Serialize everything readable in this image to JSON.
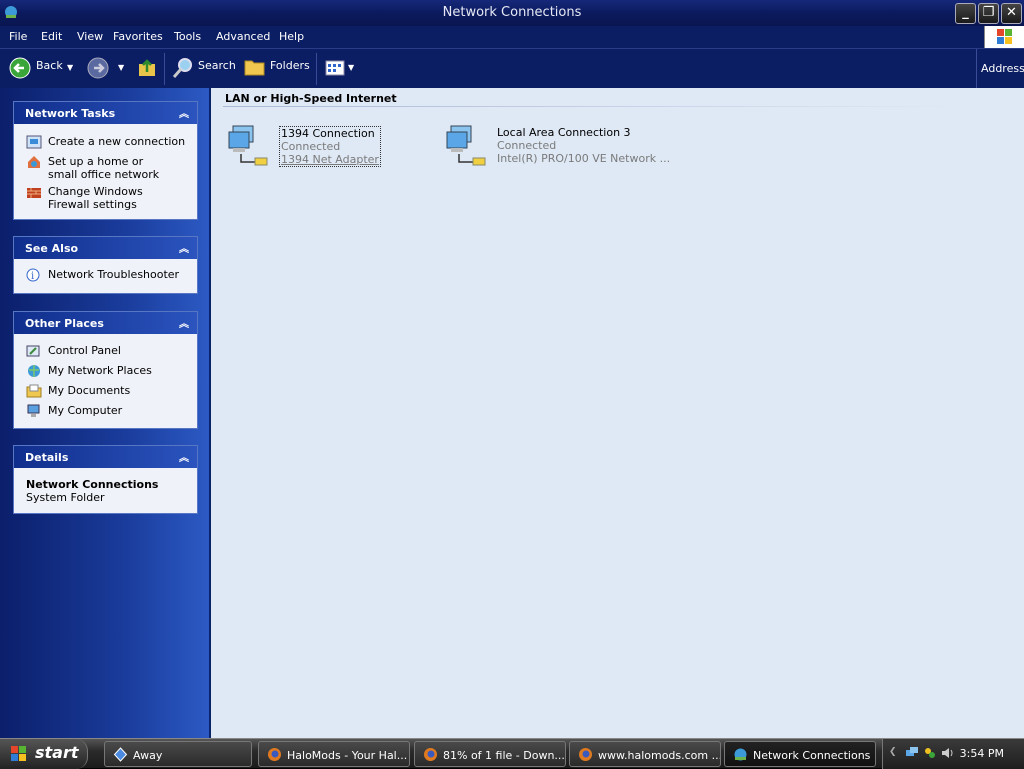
{
  "window": {
    "title": "Network Connections"
  },
  "menubar": [
    "File",
    "Edit",
    "View",
    "Favorites",
    "Tools",
    "Advanced",
    "Help"
  ],
  "toolbar": {
    "back": "Back",
    "search": "Search",
    "folders": "Folders",
    "address": "Address"
  },
  "sidebar": {
    "network_tasks": {
      "title": "Network Tasks",
      "items": [
        "Create a new connection",
        "Set up a home or small office network",
        "Change Windows Firewall settings"
      ]
    },
    "see_also": {
      "title": "See Also",
      "items": [
        "Network Troubleshooter"
      ]
    },
    "other_places": {
      "title": "Other Places",
      "items": [
        "Control Panel",
        "My Network Places",
        "My Documents",
        "My Computer"
      ]
    },
    "details": {
      "title": "Details",
      "name": "Network Connections",
      "type": "System Folder"
    }
  },
  "content": {
    "group": "LAN or High-Speed Internet",
    "connections": [
      {
        "name": "1394 Connection",
        "status": "Connected",
        "device": "1394 Net Adapter"
      },
      {
        "name": "Local Area Connection 3",
        "status": "Connected",
        "device": "Intel(R) PRO/100 VE Network ..."
      }
    ]
  },
  "taskbar": {
    "start": "start",
    "tasks": [
      "Away",
      "HaloMods - Your Hal...",
      "81% of 1 file - Down...",
      "www.halomods.com ...",
      "Network Connections"
    ],
    "clock": "3:54 PM"
  }
}
